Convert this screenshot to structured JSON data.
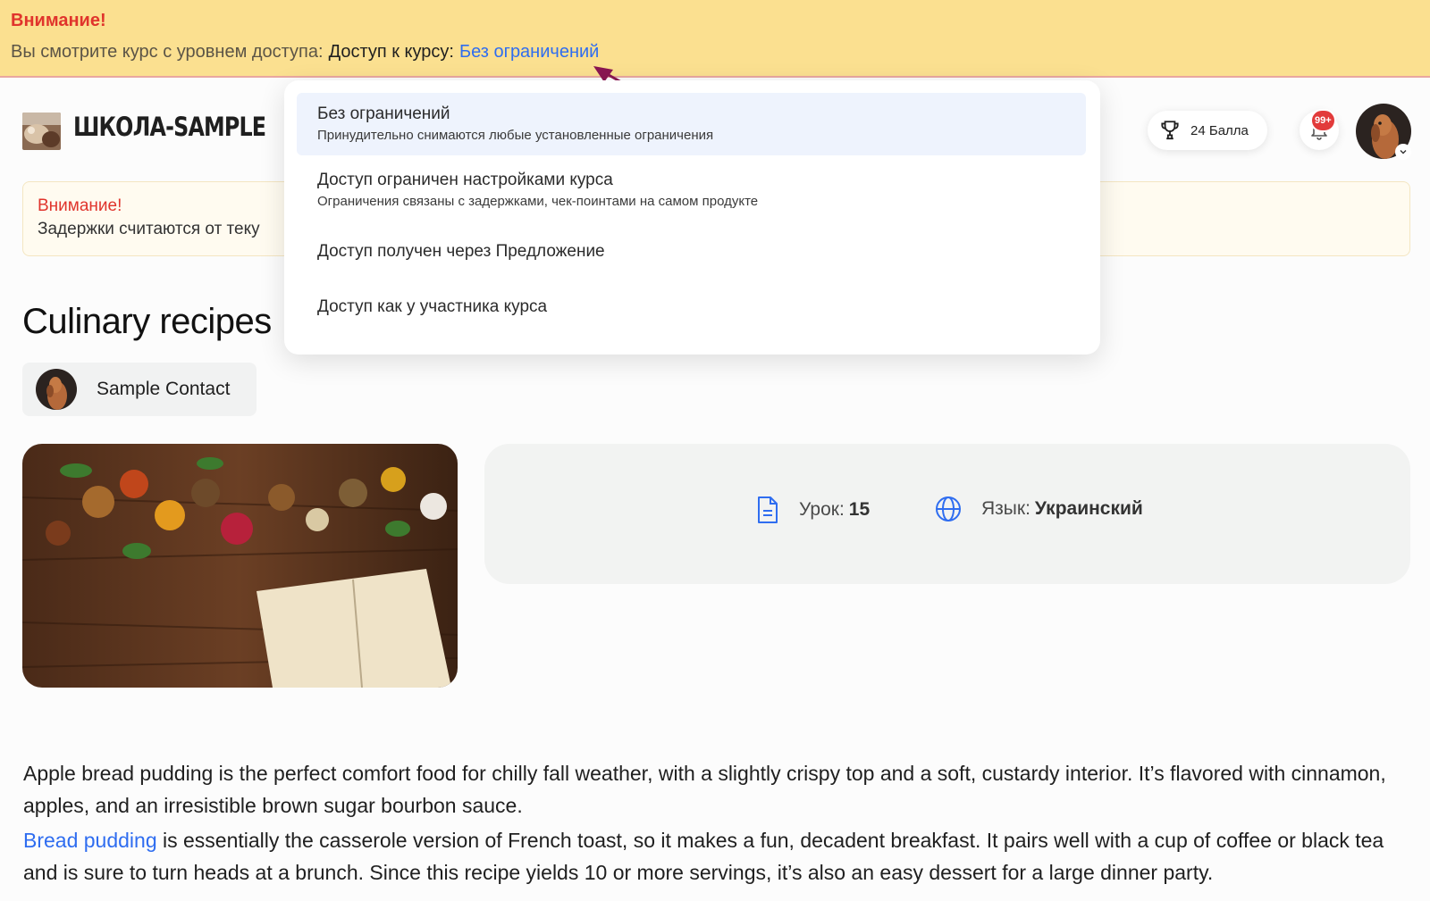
{
  "banner": {
    "title": "Внимание!",
    "prefix": "Вы смотрите курс с уровнем доступа:",
    "access_label": "Доступ к курсу:",
    "access_value": "Без ограничений"
  },
  "header": {
    "logo_text": "ШКОЛА-SAMPLE",
    "points_label": "24 Балла",
    "notifications_badge": "99+"
  },
  "notice": {
    "title": "Внимание!",
    "text": "Задержки считаются от теку"
  },
  "course": {
    "title": "Culinary recipes",
    "contact_name": "Sample Contact",
    "lessons_label": "Урок:",
    "lessons_value": "15",
    "language_label": "Язык:",
    "language_value": "Украинский"
  },
  "description": {
    "p1": "Apple bread pudding is the perfect comfort food for chilly fall weather, with a slightly crispy top and a soft, custardy interior. It’s flavored with cinnamon, apples, and an irresistible brown sugar bourbon sauce.",
    "p2_link": "Bread pudding",
    "p2_rest": " is essentially the casserole version of French toast, so it makes a fun, decadent breakfast. It pairs well with a cup of coffee or black tea and is sure to turn heads at a brunch. Since this recipe yields 10 or more servings, it’s also an easy dessert for a large dinner party."
  },
  "dropdown": {
    "options": [
      {
        "title": "Без ограничений",
        "subtitle": "Принудительно снимаются любые установленные ограничения",
        "selected": true
      },
      {
        "title": "Доступ ограничен настройками курса",
        "subtitle": "Ограничения связаны с задержками, чек-поинтами на самом продукте",
        "selected": false
      },
      {
        "title": "Доступ получен через Предложение",
        "subtitle": "",
        "selected": false
      },
      {
        "title": "Доступ как у участника курса",
        "subtitle": "",
        "selected": false
      }
    ]
  },
  "colors": {
    "banner_bg": "#fbe090",
    "warning_red": "#e0342c",
    "link_blue": "#2f6df0",
    "badge_red": "#e23b3b",
    "arrow": "#8a1651"
  },
  "icons": {
    "points": "trophy-icon",
    "notifications": "bell-icon",
    "lessons": "document-icon",
    "language": "globe-icon"
  }
}
